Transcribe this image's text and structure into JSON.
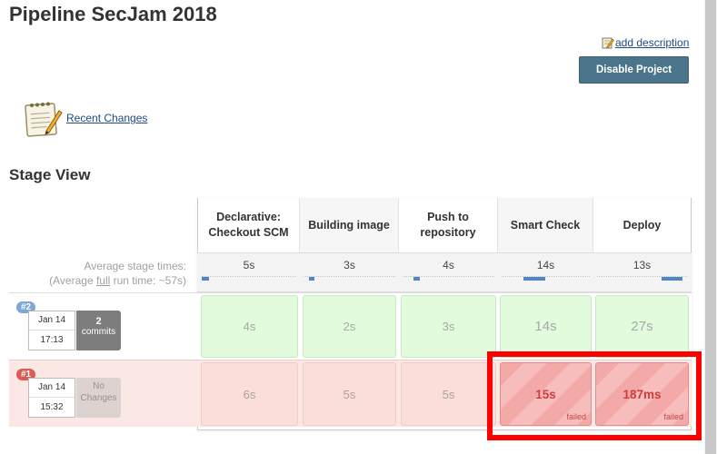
{
  "page": {
    "title": "Pipeline SecJam 2018",
    "add_description": "add description",
    "disable_button": "Disable Project",
    "recent_changes": "Recent Changes",
    "stage_view_title": "Stage View"
  },
  "stage_view": {
    "avg_label_line1": "Average stage times:",
    "avg_label_prefix": "(Average ",
    "avg_label_full": "full",
    "avg_label_suffix": " run time: ~57s)",
    "stages": [
      {
        "name": "Declarative: Checkout SCM",
        "avg": "5s",
        "avg_fraction": 0.08
      },
      {
        "name": "Building image",
        "avg": "3s",
        "avg_fraction": 0.05
      },
      {
        "name": "Push to repository",
        "avg": "4s",
        "avg_fraction": 0.07
      },
      {
        "name": "Smart Check",
        "avg": "14s",
        "avg_fraction": 0.25
      },
      {
        "name": "Deploy",
        "avg": "13s",
        "avg_fraction": 0.23
      }
    ],
    "runs": [
      {
        "badge": "#2",
        "date": "Jan 14",
        "time": "17:13",
        "changes_count": "2",
        "changes_label": "commits",
        "status": "success",
        "cells": [
          "4s",
          "2s",
          "3s",
          "14s",
          "27s"
        ]
      },
      {
        "badge": "#1",
        "date": "Jan 14",
        "time": "15:32",
        "changes_label": "No Changes",
        "status": "failure",
        "cells": [
          "6s",
          "5s",
          "5s",
          "15s",
          "187ms"
        ],
        "failed_label": "failed"
      }
    ]
  },
  "colors": {
    "success_cell": "#e1fbdc",
    "failed_cell": "#f4a9a9",
    "highlight": "#ff0000",
    "button": "#4b758b"
  }
}
